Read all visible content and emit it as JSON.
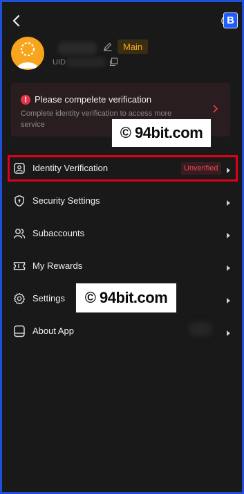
{
  "header": {
    "back_icon": "arrow-left-icon",
    "theme_icon": "moon-icon",
    "badge_letter": "B"
  },
  "profile": {
    "tag": "Main",
    "uid_label": "UID",
    "edit_icon": "pencil-icon",
    "copy_icon": "copy-icon"
  },
  "verification_card": {
    "title": "Please compelete verification",
    "description": "Complete identity verification to access more service",
    "accent_color": "#e5364a"
  },
  "watermark": {
    "text": "© 94bit.com"
  },
  "menu": {
    "identity": {
      "label": "Identity Verification",
      "status": "Unverified",
      "icon": "id-card-icon"
    },
    "security": {
      "label": "Security Settings",
      "icon": "shield-icon"
    },
    "subaccounts": {
      "label": "Subaccounts",
      "icon": "users-icon"
    },
    "rewards": {
      "label": "My Rewards",
      "icon": "ticket-icon"
    },
    "settings": {
      "label": "Settings",
      "icon": "gear-icon"
    },
    "about": {
      "label": "About App",
      "icon": "app-icon"
    }
  },
  "colors": {
    "background": "#191919",
    "highlight_border": "#e0001a",
    "tag_main": "#f4a623",
    "frame": "#1f4fd6"
  }
}
